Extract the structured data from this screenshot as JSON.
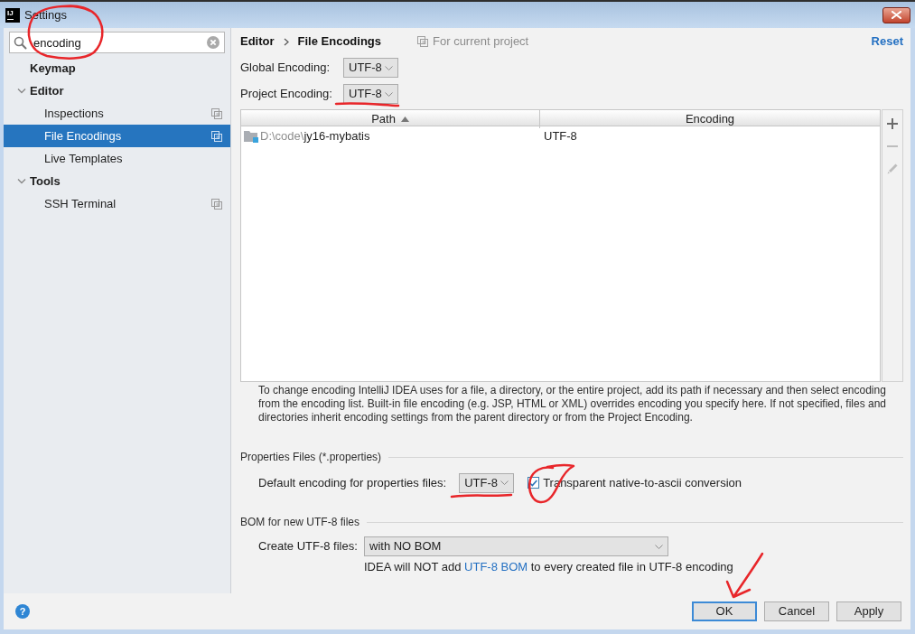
{
  "window": {
    "logo": "IJ",
    "title": "Settings"
  },
  "sidebar": {
    "search": {
      "value": "encoding"
    },
    "tree": [
      {
        "label": "Keymap",
        "selected": false,
        "per_project": false
      },
      {
        "label": "Editor",
        "selected": false,
        "per_project": false,
        "expanded": true,
        "children": [
          {
            "label": "Inspections",
            "selected": false,
            "per_project": true
          },
          {
            "label": "File Encodings",
            "selected": true,
            "per_project": true
          },
          {
            "label": "Live Templates",
            "selected": false,
            "per_project": false
          }
        ]
      },
      {
        "label": "Tools",
        "selected": false,
        "per_project": false,
        "expanded": true,
        "children": [
          {
            "label": "SSH Terminal",
            "selected": false,
            "per_project": true
          }
        ]
      }
    ]
  },
  "header": {
    "breadcrumb": [
      "Editor",
      "File Encodings"
    ],
    "scope": "For current project",
    "reset": "Reset"
  },
  "encodings": [
    {
      "label": "Global Encoding:",
      "value": "UTF-8"
    },
    {
      "label": "Project Encoding:",
      "value": "UTF-8"
    }
  ],
  "table": {
    "columns": [
      {
        "label": "Path",
        "sorted": true
      },
      {
        "label": "Encoding",
        "sorted": false
      }
    ],
    "rows": [
      {
        "path_parent": "D:\\code\\",
        "path_name": "jy16-mybatis",
        "encoding": "UTF-8"
      }
    ],
    "toolbar": [
      {
        "kind": "add",
        "disabled": false
      },
      {
        "kind": "remove",
        "disabled": true
      },
      {
        "kind": "edit",
        "disabled": true
      }
    ]
  },
  "help_text": "To change encoding IntelliJ IDEA uses for a file, a directory, or the entire project, add its path if necessary and then select encoding from the encoding list. Built-in file encoding (e.g. JSP, HTML or XML) overrides encoding you specify here. If not specified, files and directories inherit encoding settings from the parent directory or from the Project Encoding.",
  "properties_files": {
    "title": "Properties Files (*.properties)",
    "label": "Default encoding for properties files:",
    "value": "UTF-8",
    "transparent": {
      "label": "Transparent native-to-ascii conversion",
      "checked": true
    }
  },
  "bom": {
    "title": "BOM for new UTF-8 files",
    "label": "Create UTF-8 files:",
    "value": "with NO BOM",
    "note": [
      {
        "kind": "text",
        "text": "IDEA will NOT add"
      },
      {
        "kind": "link",
        "text": "UTF-8 BOM"
      },
      {
        "kind": "text",
        "text": "to every created file in UTF-8 encoding"
      }
    ]
  },
  "footer": {
    "help": "?",
    "buttons": [
      {
        "label": "OK",
        "focused": true
      },
      {
        "label": "Cancel",
        "focused": false
      },
      {
        "label": "Apply",
        "focused": false
      }
    ]
  }
}
